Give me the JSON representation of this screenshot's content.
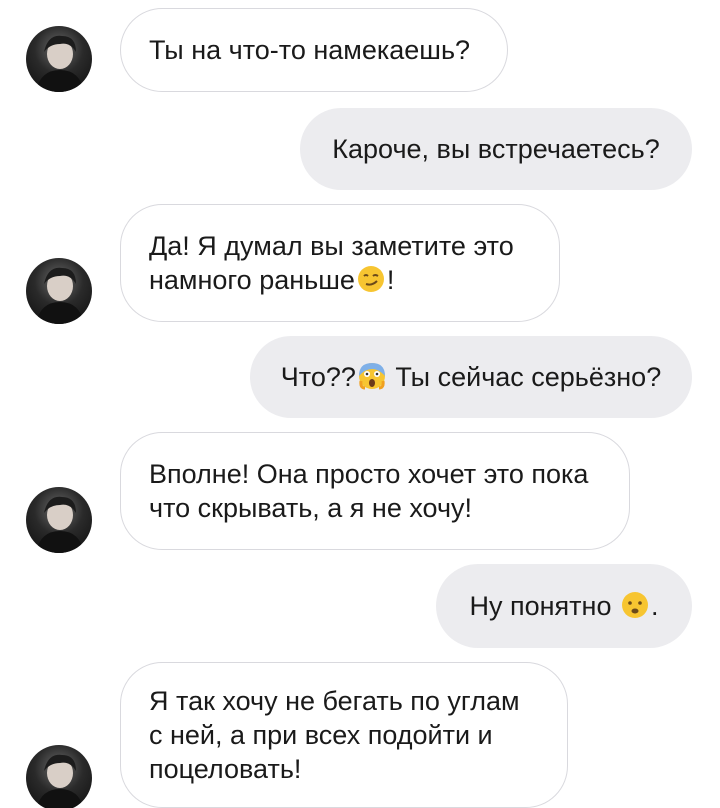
{
  "chat": {
    "colors": {
      "incoming_bubble": "#ffffff",
      "incoming_border": "#d9d9de",
      "outgoing_bubble": "#ececef",
      "text": "#1a1a1a"
    },
    "messages": [
      {
        "side": "incoming",
        "text": "Ты на что-то намекаешь?"
      },
      {
        "side": "outgoing",
        "text": "Кароче, вы встречаетесь?"
      },
      {
        "side": "incoming",
        "text_before": "Да! Я думал вы заметите это\nнамного раньше",
        "emoji": "smirking-face-icon",
        "text_after": "!"
      },
      {
        "side": "outgoing",
        "text_before": "Что??",
        "emoji": "screaming-face-icon",
        "text_after": " Ты сейчас серьёзно?"
      },
      {
        "side": "incoming",
        "text": "Вполне! Она просто хочет это пока\nчто скрывать, а я не хочу!"
      },
      {
        "side": "outgoing",
        "text_before": "Ну понятно ",
        "emoji": "sad-face-icon",
        "text_after": "."
      },
      {
        "side": "incoming",
        "text": "Я так хочу не бегать по углам\nс ней, а при всех подойти и\nпоцеловать!"
      }
    ]
  }
}
